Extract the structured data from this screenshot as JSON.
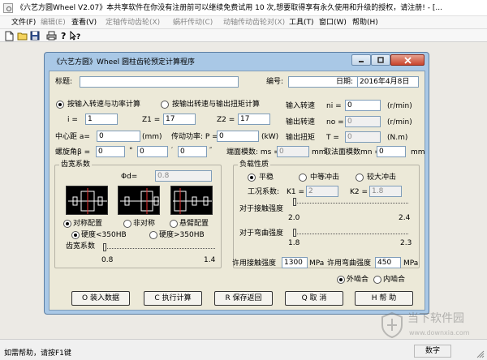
{
  "window": {
    "title": "《六艺方圆Wheel V2.07》本共享软件在你没有注册前可以继续免费试用 10 次,想要取得享有永久使用和升级的授权，请注册! - [..."
  },
  "menu": [
    "文件(F)",
    "编辑(E)",
    "查看(V)",
    "定轴传动齿轮(X)",
    "蜗杆传动(C)",
    "动轴传动齿轮对(X)",
    "工具(T)",
    "窗口(W)",
    "帮助(H)"
  ],
  "toolbar_icons": [
    "new-file-icon",
    "open-folder-icon",
    "save-icon",
    "print-icon",
    "help-icon",
    "context-help-icon"
  ],
  "dialog": {
    "title": "《六艺方圆》Wheel 圆柱齿轮预定计算程序",
    "header": {
      "title_label": "标题:",
      "title_value": "",
      "number_label": "编号:",
      "number_value": "",
      "date_label": "日期:",
      "date_value": "2016年4月8日"
    },
    "mode": {
      "option_power": "按输入转速与功率计算",
      "option_torque": "按输出转速与输出扭矩计算",
      "selected": "option_power"
    },
    "ratio": {
      "i_label": "i =",
      "i_value": "1",
      "z1_label": "Z1 =",
      "z1_value": "17",
      "z2_label": "Z2 =",
      "z2_value": "17"
    },
    "speeds": {
      "input_speed_label": "输入转速",
      "ni_label": "ni =",
      "ni_value": "0",
      "ni_unit": "(r/min)",
      "output_speed_label": "输出转速",
      "no_label": "no =",
      "no_value": "0",
      "no_unit": "(r/min)",
      "output_torque_label": "输出扭矩",
      "t_label": "T =",
      "t_value": "0",
      "t_unit": "(N.m)"
    },
    "center": {
      "label": "中心距 a=",
      "value": "0",
      "unit": "(mm)"
    },
    "power": {
      "label": "传动功率: P =",
      "value": "0",
      "unit": "(kW)"
    },
    "helix": {
      "label": "螺旋角β =",
      "deg": "0",
      "deg_sym": "°",
      "min": "0",
      "min_sym": "′",
      "sec": "0",
      "sec_sym": "″"
    },
    "module": {
      "mn_label": "端面模数: ms =",
      "mn_value": "0",
      "mn_unit": "mm",
      "mn_std_label": "取法面模数mn =",
      "mn_std_value": "0",
      "mn_std_unit": "mm"
    },
    "width_group": {
      "label": "齿宽系数",
      "phi_label": "Φd=",
      "phi_value": "0.8",
      "layout_symmetric": "对称配置",
      "layout_asymmetric": "非对称",
      "layout_cantilever": "悬臂配置",
      "layout_selected": "layout_symmetric",
      "hard_low": "硬度<350HB",
      "hard_high": "硬度>350HB",
      "hardness_selected": "hard_low",
      "slider_label": "齿宽系数",
      "slider_min": "0.8",
      "slider_max": "1.4",
      "slider_level": 0.0
    },
    "load_group": {
      "label": "负载性质",
      "option_steady": "平稳",
      "option_medium": "中等冲击",
      "option_heavy": "较大冲击",
      "selected": "option_steady",
      "factor_label": "工况系数:",
      "k1_label": "K1 =",
      "k1_value": "2",
      "k2_label": "K2 =",
      "k2_value": "1.8",
      "contact_label": "对于接触强度",
      "contact_min": "2.0",
      "contact_max": "2.4",
      "contact_level": 0.0,
      "bending_label": "对于弯曲强度",
      "bending_min": "1.8",
      "bending_max": "2.3",
      "bending_level": 0.0
    },
    "strength": {
      "contact_label": "许用接触强度",
      "contact_value": "1300",
      "contact_unit": "MPa",
      "bending_label": "许用弯曲强度",
      "bending_value": "450",
      "bending_unit": "MPa"
    },
    "mesh": {
      "external": "外啮合",
      "internal": "内啮合",
      "selected": "external"
    },
    "buttons": {
      "load": "O 装入数据",
      "compute": "C 执行计算",
      "save_return": "R 保存返回",
      "cancel": "Q 取  消",
      "help": "H 帮  助"
    }
  },
  "status": {
    "help_hint": "如需帮助，请按F1键",
    "num_indicator": "数字"
  },
  "watermark": {
    "cn": "当下软件园",
    "en": "www.downxia.com"
  },
  "colors": {
    "dialog_frame": "#a9c8e6",
    "dialog_face": "#ece9d8",
    "close_button": "#c9452d",
    "workspace": "#eceae5"
  }
}
